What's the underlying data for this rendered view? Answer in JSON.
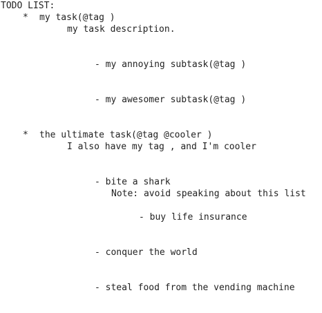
{
  "title": "TODO LIST:",
  "tasks": [
    {
      "bullet": "*",
      "title": "my task(@tag )",
      "description": "my task description.",
      "subtasks": [
        {
          "text": "- my annoying subtask(@tag )"
        },
        {
          "text": "- my awesomer subtask(@tag )"
        }
      ]
    },
    {
      "bullet": "*",
      "title": "the ultimate task(@tag @cooler )",
      "description": "I also have my tag , and I'm cooler",
      "subtasks": [
        {
          "text": "- bite a shark",
          "note": "Note: avoid speaking about this list",
          "subtasks": [
            {
              "text": "- buy life insurance"
            }
          ]
        },
        {
          "text": "- conquer the world"
        },
        {
          "text": "- steal food from the vending machine"
        }
      ]
    }
  ]
}
